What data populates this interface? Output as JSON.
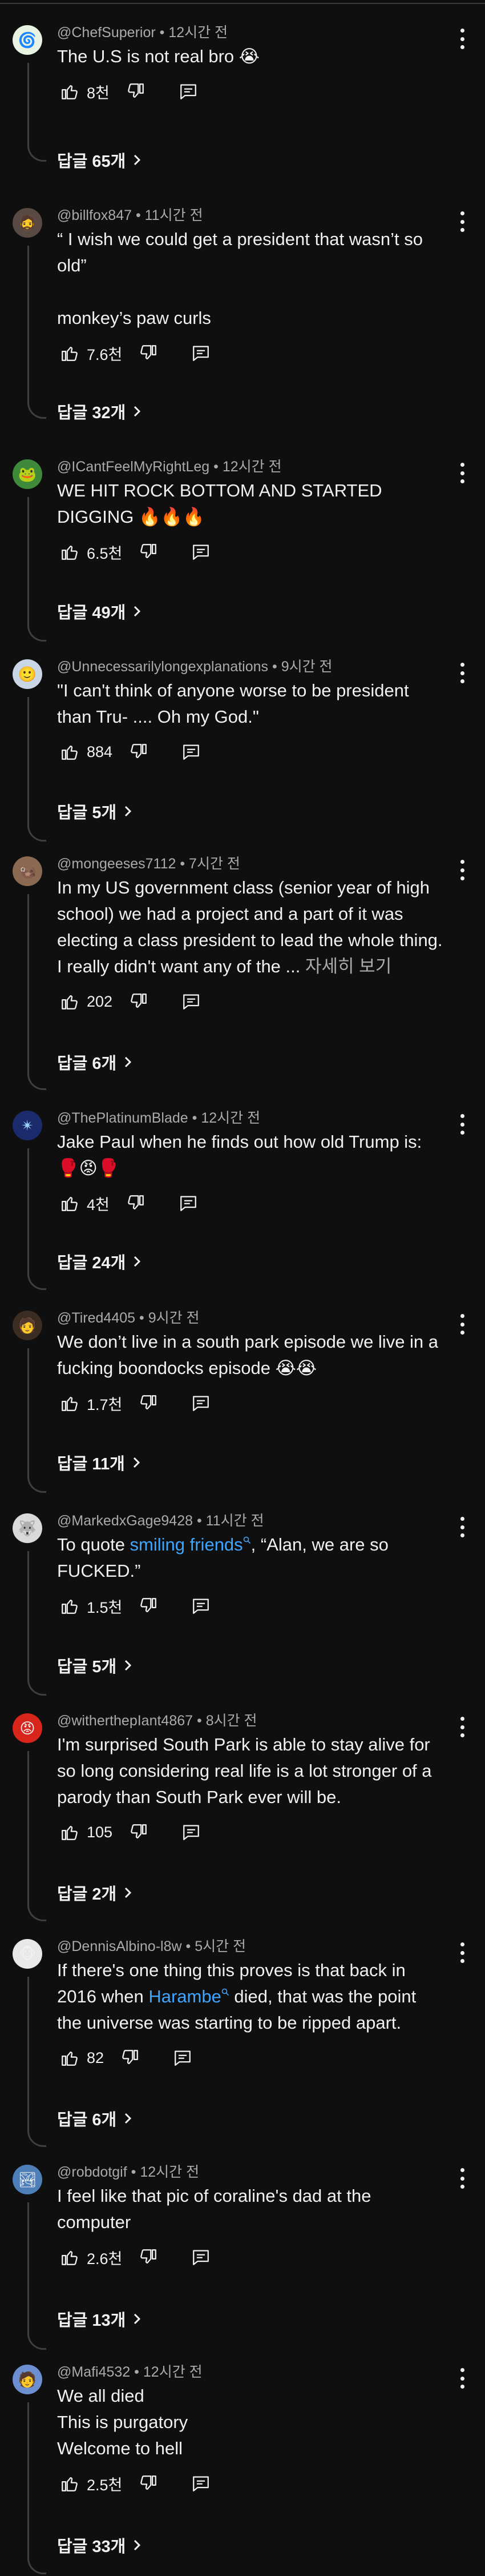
{
  "comments": [
    {
      "handle": "@ChefSuperior",
      "sep": " • ",
      "time": "12시간 전",
      "text": "The U.S is not real bro 😭",
      "likes": "8천",
      "replies": "답글 65개",
      "avatar_color": "#e9f3e1",
      "avatar_glyph": "🌀"
    },
    {
      "handle": "@billfox847",
      "sep": " • ",
      "time": "11시간 전",
      "text": "“ I wish we could get a president that wasn’t so old”\n\nmonkey’s paw curls",
      "likes": "7.6천",
      "replies": "답글 32개",
      "avatar_color": "#5a4a44",
      "avatar_glyph": "🧔"
    },
    {
      "handle": "@ICantFeelMyRightLeg",
      "sep": " • ",
      "time": "12시간 전",
      "text": "WE HIT ROCK BOTTOM AND STARTED DIGGING 🔥🔥🔥",
      "likes": "6.5천",
      "replies": "답글 49개",
      "avatar_color": "#3f8a3a",
      "avatar_glyph": "🐸"
    },
    {
      "handle": "@Unnecessarilylongexplanations",
      "sep": " • ",
      "time": "9시간 전",
      "text": "\"I can't think of anyone worse to be president than Tru- .... Oh my God.\"",
      "likes": "884",
      "replies": "답글 5개",
      "avatar_color": "#c9d6e6",
      "avatar_glyph": "🙂"
    },
    {
      "handle": "@mongeeses7112",
      "sep": " • ",
      "time": "7시간 전",
      "text": "In my US government class (senior year of high school) we had a project and a part of it was electing a class president to lead the whole thing. I really didn't want any of the ...",
      "more": "자세히 보기",
      "likes": "202",
      "replies": "답글 6개",
      "avatar_color": "#8a6a52",
      "avatar_glyph": "🦦"
    },
    {
      "handle": "@ThePlatinumBlade",
      "sep": " • ",
      "time": "12시간 전",
      "text": "Jake Paul when he finds out how old Trump is: 🥊😡🥊",
      "likes": "4천",
      "replies": "답글 24개",
      "avatar_color": "#1b2a6b",
      "avatar_glyph": "✴"
    },
    {
      "handle": "@Tired4405",
      "sep": " • ",
      "time": "9시간 전",
      "text": "We don’t live in a south park episode we live in a fucking boondocks episode 😭😭",
      "likes": "1.7천",
      "replies": "답글 11개",
      "avatar_color": "#3a2c20",
      "avatar_glyph": "🧑"
    },
    {
      "handle": "@MarkedxGage9428",
      "sep": " • ",
      "time": "11시간 전",
      "text_before": "To quote ",
      "link": "smiling friends",
      "text_after": ", “Alan, we are so FUCKED.”",
      "likes": "1.5천",
      "replies": "답글 5개",
      "avatar_color": "#d9d9d9",
      "avatar_glyph": "🐺"
    },
    {
      "handle": "@witherthepIant4867",
      "sep": " • ",
      "time": "8시간 전",
      "text": "I'm surprised South Park is able to stay alive for so long considering real life is a lot stronger of a parody than South Park ever will be.",
      "likes": "105",
      "replies": "답글 2개",
      "avatar_color": "#d8251c",
      "avatar_glyph": "😡"
    },
    {
      "handle": "@DennisAlbino-l8w",
      "sep": " • ",
      "time": "5시간 전",
      "text_before": "If there's one thing this proves is that back in 2016 when ",
      "link": "Harambe",
      "text_after": " died, that was the point the universe was starting to be ripped apart.",
      "likes": "82",
      "replies": "답글 6개",
      "avatar_color": "#e8e8e8",
      "avatar_glyph": "🐵"
    },
    {
      "handle": "@robdotgif",
      "sep": " • ",
      "time": "12시간 전",
      "text": "I feel like that pic of coraline's dad at the computer",
      "likes": "2.6천",
      "replies": "답글 13개",
      "avatar_color": "#4f7fb8",
      "avatar_glyph": "🏞"
    },
    {
      "handle": "@Mafi4532",
      "sep": " • ",
      "time": "12시간 전",
      "text": "We all died\nThis is purgatory\nWelcome to hell",
      "likes": "2.5천",
      "replies": "답글 33개",
      "avatar_color": "#6b8fd1",
      "avatar_glyph": "🧑"
    }
  ]
}
